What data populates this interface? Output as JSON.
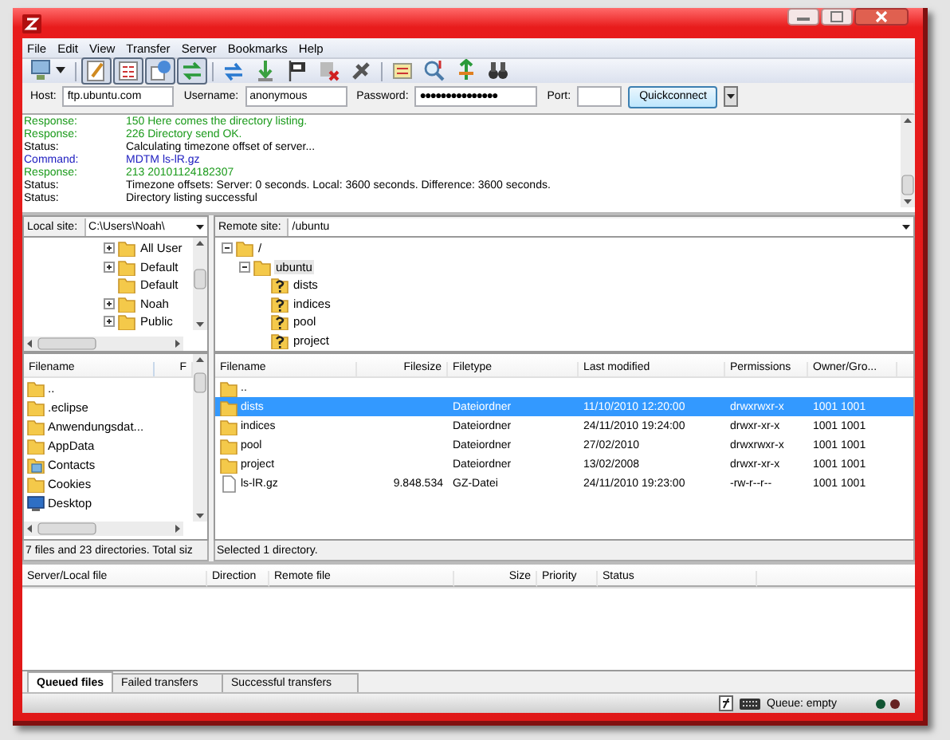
{
  "menu": [
    "File",
    "Edit",
    "View",
    "Transfer",
    "Server",
    "Bookmarks",
    "Help"
  ],
  "toolbar": [
    {
      "kind": "site-manager"
    },
    {
      "kind": "separator"
    },
    {
      "kind": "log",
      "pressed": true
    },
    {
      "kind": "local-tree",
      "pressed": true
    },
    {
      "kind": "remote-tree",
      "pressed": true
    },
    {
      "kind": "queue",
      "pressed": true
    },
    {
      "kind": "separator"
    },
    {
      "kind": "refresh"
    },
    {
      "kind": "process"
    },
    {
      "kind": "flag"
    },
    {
      "kind": "cancel"
    },
    {
      "kind": "disconnect"
    },
    {
      "kind": "separator"
    },
    {
      "kind": "compare"
    },
    {
      "kind": "filter"
    },
    {
      "kind": "sync"
    },
    {
      "kind": "search"
    }
  ],
  "quickconnect": {
    "host_label": "Host:",
    "host": "ftp.ubuntu.com",
    "username_label": "Username:",
    "username": "anonymous",
    "password_label": "Password:",
    "password": "●●●●●●●●●●●●●●●",
    "port_label": "Port:",
    "button": "Quickconnect"
  },
  "log": [
    {
      "kind": "response",
      "label": "Response:",
      "text": "150 Here comes the directory listing."
    },
    {
      "kind": "response",
      "label": "Response:",
      "text": "226 Directory send OK."
    },
    {
      "kind": "status",
      "label": "Status:",
      "text": "Calculating timezone offset of server..."
    },
    {
      "kind": "command",
      "label": "Command:",
      "text": "MDTM ls-lR.gz"
    },
    {
      "kind": "response",
      "label": "Response:",
      "text": "213 20101124182307"
    },
    {
      "kind": "status",
      "label": "Status:",
      "text": "Timezone offsets: Server: 0 seconds. Local: 3600 seconds. Difference: 3600 seconds."
    },
    {
      "kind": "status",
      "label": "Status:",
      "text": "Directory listing successful"
    }
  ],
  "local": {
    "label": "Local site:",
    "path": "C:\\Users\\Noah\\",
    "tree": [
      {
        "name": "All User",
        "has_children": true
      },
      {
        "name": "Default",
        "has_children": true
      },
      {
        "name": "Default",
        "has_children": false
      },
      {
        "name": "Noah",
        "has_children": true
      },
      {
        "name": "Public",
        "has_children": true
      }
    ],
    "columns": [
      "Filename",
      "F"
    ],
    "files": [
      {
        "name": "..",
        "kind": "folder"
      },
      {
        "name": ".eclipse",
        "kind": "folder"
      },
      {
        "name": "Anwendungsdat...",
        "kind": "folder"
      },
      {
        "name": "AppData",
        "kind": "folder"
      },
      {
        "name": "Contacts",
        "kind": "contacts"
      },
      {
        "name": "Cookies",
        "kind": "folder"
      },
      {
        "name": "Desktop",
        "kind": "desktop"
      }
    ],
    "status": "7 files and 23 directories. Total siz"
  },
  "remote": {
    "label": "Remote site:",
    "path": "/ubuntu",
    "tree": [
      {
        "name": "/",
        "kind": "folder",
        "expanded": true,
        "selected": false,
        "children": [
          {
            "name": "ubuntu",
            "kind": "folder",
            "expanded": true,
            "selected": true,
            "children": [
              {
                "name": "dists",
                "kind": "unknown",
                "selected": false
              },
              {
                "name": "indices",
                "kind": "unknown",
                "selected": false
              },
              {
                "name": "pool",
                "kind": "unknown",
                "selected": false
              },
              {
                "name": "project",
                "kind": "unknown",
                "selected": false
              }
            ]
          }
        ]
      }
    ],
    "columns": [
      "Filename",
      "Filesize",
      "Filetype",
      "Last modified",
      "Permissions",
      "Owner/Gro..."
    ],
    "files": [
      {
        "kind": "folder",
        "selected": false,
        "cells": [
          ".."
        ]
      },
      {
        "kind": "folder",
        "selected": true,
        "cells": [
          "dists",
          "",
          "Dateiordner",
          "11/10/2010 12:20:00",
          "drwxrwxr-x",
          "1001 1001"
        ]
      },
      {
        "kind": "folder",
        "selected": false,
        "cells": [
          "indices",
          "",
          "Dateiordner",
          "24/11/2010 19:24:00",
          "drwxr-xr-x",
          "1001 1001"
        ]
      },
      {
        "kind": "folder",
        "selected": false,
        "cells": [
          "pool",
          "",
          "Dateiordner",
          "27/02/2010",
          "drwxrwxr-x",
          "1001 1001"
        ]
      },
      {
        "kind": "folder",
        "selected": false,
        "cells": [
          "project",
          "",
          "Dateiordner",
          "13/02/2008",
          "drwxr-xr-x",
          "1001 1001"
        ]
      },
      {
        "kind": "file",
        "selected": false,
        "cells": [
          "ls-lR.gz",
          "9.848.534",
          "GZ-Datei",
          "24/11/2010 19:23:00",
          "-rw-r--r--",
          "1001 1001"
        ]
      }
    ],
    "status": "Selected 1 directory."
  },
  "queue": {
    "columns": [
      "Server/Local file",
      "Direction",
      "Remote file",
      "Size",
      "Priority",
      "Status"
    ],
    "tabs": [
      {
        "label": "Queued files",
        "selected": true
      },
      {
        "label": "Failed transfers",
        "selected": false
      },
      {
        "label": "Successful transfers",
        "selected": false
      }
    ]
  },
  "status_bar": {
    "queue": "Queue: empty"
  }
}
